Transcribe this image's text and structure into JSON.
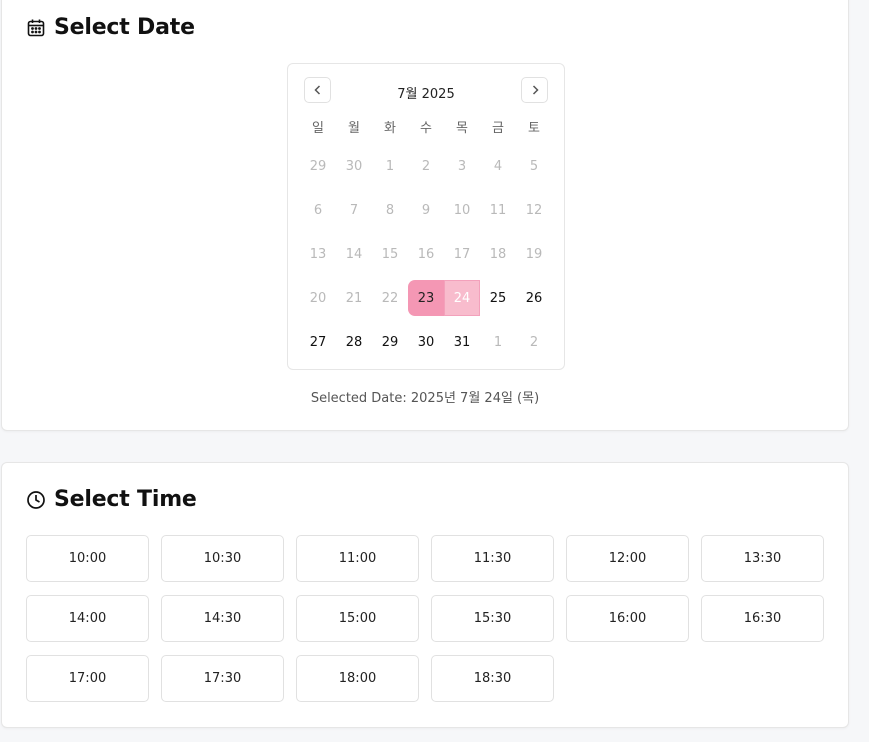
{
  "date_section": {
    "title": "Select Date",
    "icon": "calendar-icon",
    "calendar": {
      "month_label": "7월 2025",
      "prev_icon": "chevron-left-icon",
      "next_icon": "chevron-right-icon",
      "weekdays": [
        "일",
        "월",
        "화",
        "수",
        "목",
        "금",
        "토"
      ],
      "weeks": [
        [
          "29",
          "30",
          "1",
          "2",
          "3",
          "4",
          "5"
        ],
        [
          "6",
          "7",
          "8",
          "9",
          "10",
          "11",
          "12"
        ],
        [
          "13",
          "14",
          "15",
          "16",
          "17",
          "18",
          "19"
        ],
        [
          "20",
          "21",
          "22",
          "23",
          "24",
          "25",
          "26"
        ],
        [
          "27",
          "28",
          "29",
          "30",
          "31",
          "1",
          "2"
        ]
      ],
      "today": "23",
      "selected": "24",
      "today_color": "#f497b4",
      "selected_color": "#f8bccd"
    },
    "selected_text": "Selected Date: 2025년 7월 24일 (목)"
  },
  "time_section": {
    "title": "Select Time",
    "icon": "clock-icon",
    "slots": [
      "10:00",
      "10:30",
      "11:00",
      "11:30",
      "12:00",
      "13:30",
      "14:00",
      "14:30",
      "15:00",
      "15:30",
      "16:00",
      "16:30",
      "17:00",
      "17:30",
      "18:00",
      "18:30"
    ]
  }
}
